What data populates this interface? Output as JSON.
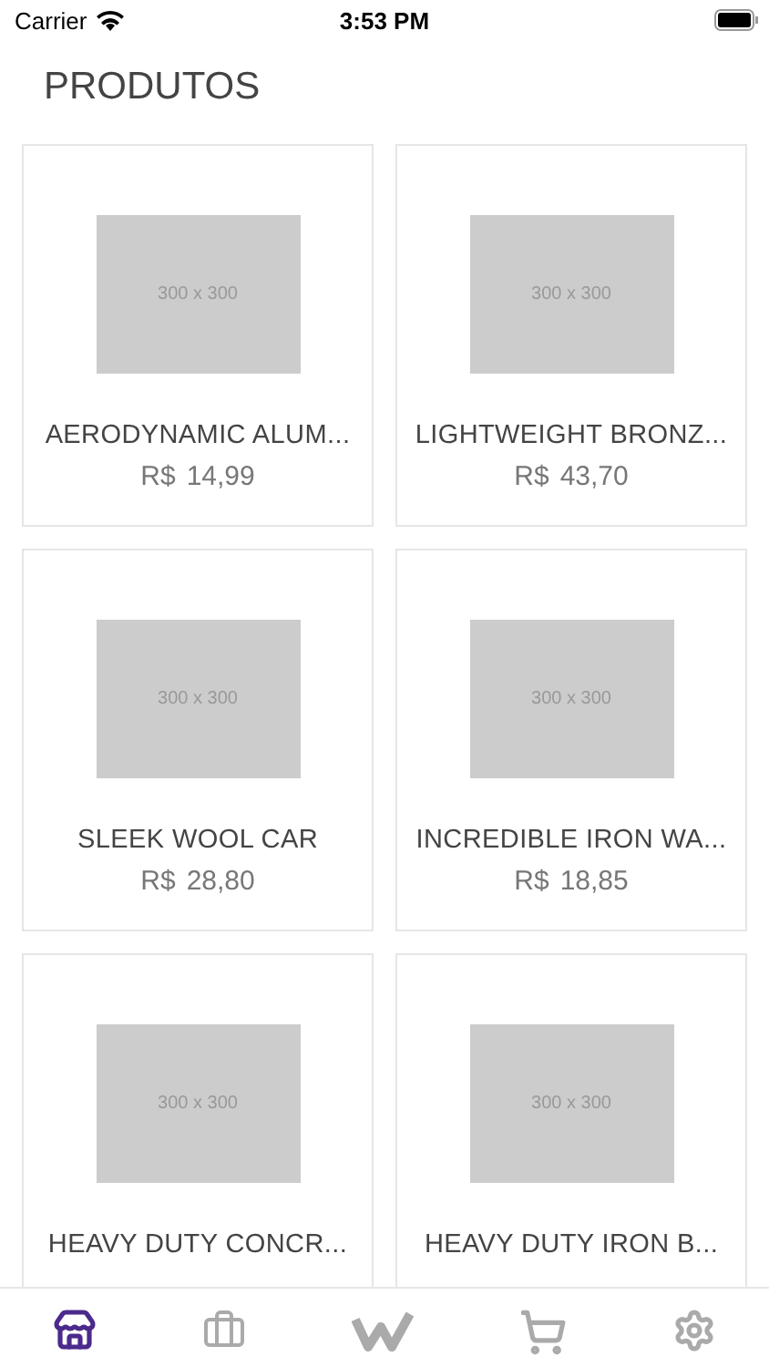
{
  "status_bar": {
    "carrier": "Carrier",
    "time": "3:53 PM"
  },
  "title": "PRODUTOS",
  "products": [
    {
      "image_text": "300 x 300",
      "name": "AERODYNAMIC ALUM...",
      "currency": "R$",
      "price": "14,99"
    },
    {
      "image_text": "300 x 300",
      "name": "LIGHTWEIGHT BRONZ...",
      "currency": "R$",
      "price": "43,70"
    },
    {
      "image_text": "300 x 300",
      "name": "SLEEK WOOL CAR",
      "currency": "R$",
      "price": "28,80"
    },
    {
      "image_text": "300 x 300",
      "name": "INCREDIBLE IRON WA...",
      "currency": "R$",
      "price": "18,85"
    },
    {
      "image_text": "300 x 300",
      "name": "HEAVY DUTY CONCR..."
    },
    {
      "image_text": "300 x 300",
      "name": "HEAVY DUTY IRON B..."
    }
  ],
  "tab_bar": [
    {
      "kind": "store",
      "selected": true
    },
    {
      "kind": "briefcase",
      "selected": false
    },
    {
      "kind": "logo",
      "selected": false
    },
    {
      "kind": "cart",
      "selected": false
    },
    {
      "kind": "settings",
      "selected": false
    }
  ]
}
